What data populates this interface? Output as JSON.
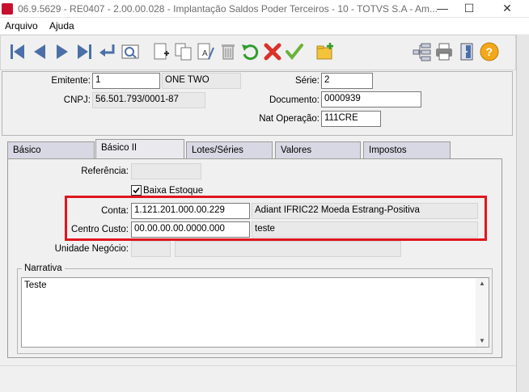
{
  "window": {
    "title": "06.9.5629 - RE0407 - 2.00.00.028 - Implantação Saldos Poder Terceiros - 10 - TOTVS S.A - Am...",
    "minimize": "—",
    "maximize": "☐",
    "close": "✕"
  },
  "menu": {
    "items": [
      "Arquivo",
      "Ajuda"
    ]
  },
  "header": {
    "emitente_label": "Emitente:",
    "emitente_value": "1",
    "emitente_name": "ONE TWO",
    "cnpj_label": "CNPJ:",
    "cnpj_value": "56.501.793/0001-87",
    "serie_label": "Série:",
    "serie_value": "2",
    "documento_label": "Documento:",
    "documento_value": "0000939",
    "natop_label": "Nat Operação:",
    "natop_value": "111CRE"
  },
  "tabs": [
    "Básico",
    "Básico II",
    "Lotes/Séries",
    "Valores",
    "Impostos"
  ],
  "active_tab": "Básico II",
  "form": {
    "referencia_label": "Referência:",
    "referencia_value": "",
    "baixa_label": "Baixa Estoque",
    "baixa_checked": true,
    "conta_label": "Conta:",
    "conta_value": "1.121.201.000.00.229",
    "conta_desc": "Adiant IFRIC22 Moeda Estrang-Positiva",
    "cc_label": "Centro Custo:",
    "cc_value": "00.00.00.00.0000.000",
    "cc_desc": "teste",
    "un_label": "Unidade Negócio:",
    "un_value": "",
    "un_desc": ""
  },
  "narrativa": {
    "title": "Narrativa",
    "text": "Teste"
  },
  "colors": {
    "highlight": "#e0161e",
    "tab_bg": "#d8d8e4"
  }
}
